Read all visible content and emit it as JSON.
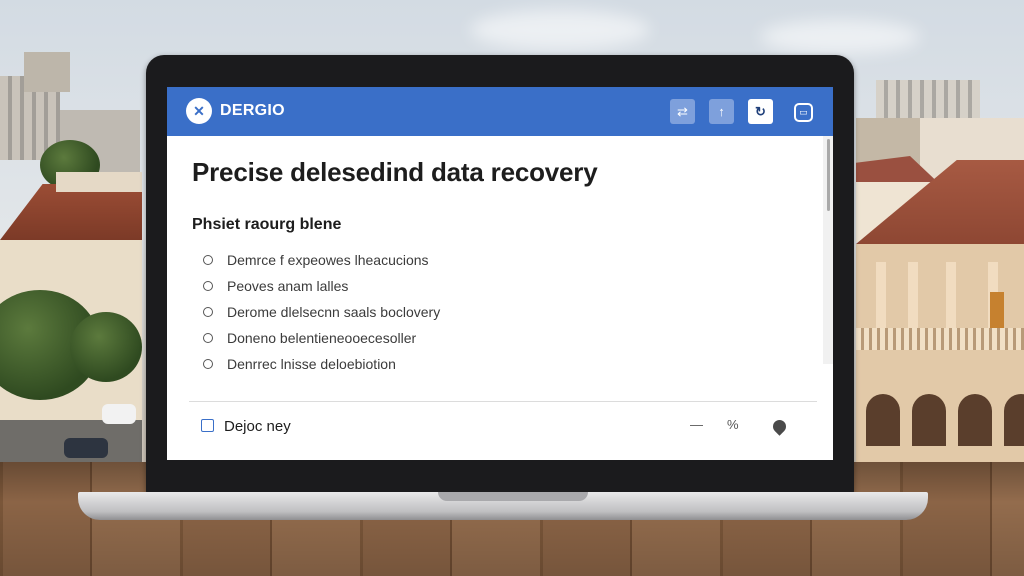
{
  "app": {
    "brand": "DERGIO",
    "logo_icon": "bird-logo-icon",
    "header_buttons": [
      {
        "icon": "transfer-icon",
        "glyph": "⇄"
      },
      {
        "icon": "upload-icon",
        "glyph": "↑"
      },
      {
        "icon": "refresh-icon",
        "glyph": "↻"
      },
      {
        "icon": "window-icon",
        "glyph": "▭"
      }
    ]
  },
  "main": {
    "title": "Precise delesedind data recovery",
    "subtitle": "Phsiet raourg blene",
    "options": [
      "Demrce f expeowes lheacucions",
      "Peoves anam lalles",
      "Derome dlelsecnn saals boclovery",
      "Doneno belentieneooecesoller",
      "Denrrec lnisse deloebiotion"
    ]
  },
  "footer": {
    "checkbox_label": "Dejoc ney",
    "icons": [
      {
        "name": "minus-icon",
        "glyph": "—"
      },
      {
        "name": "percent-icon",
        "glyph": "%"
      },
      {
        "name": "pin-icon",
        "glyph": ""
      }
    ]
  },
  "colors": {
    "header": "#3a6fc8",
    "text": "#1d1d1d"
  }
}
